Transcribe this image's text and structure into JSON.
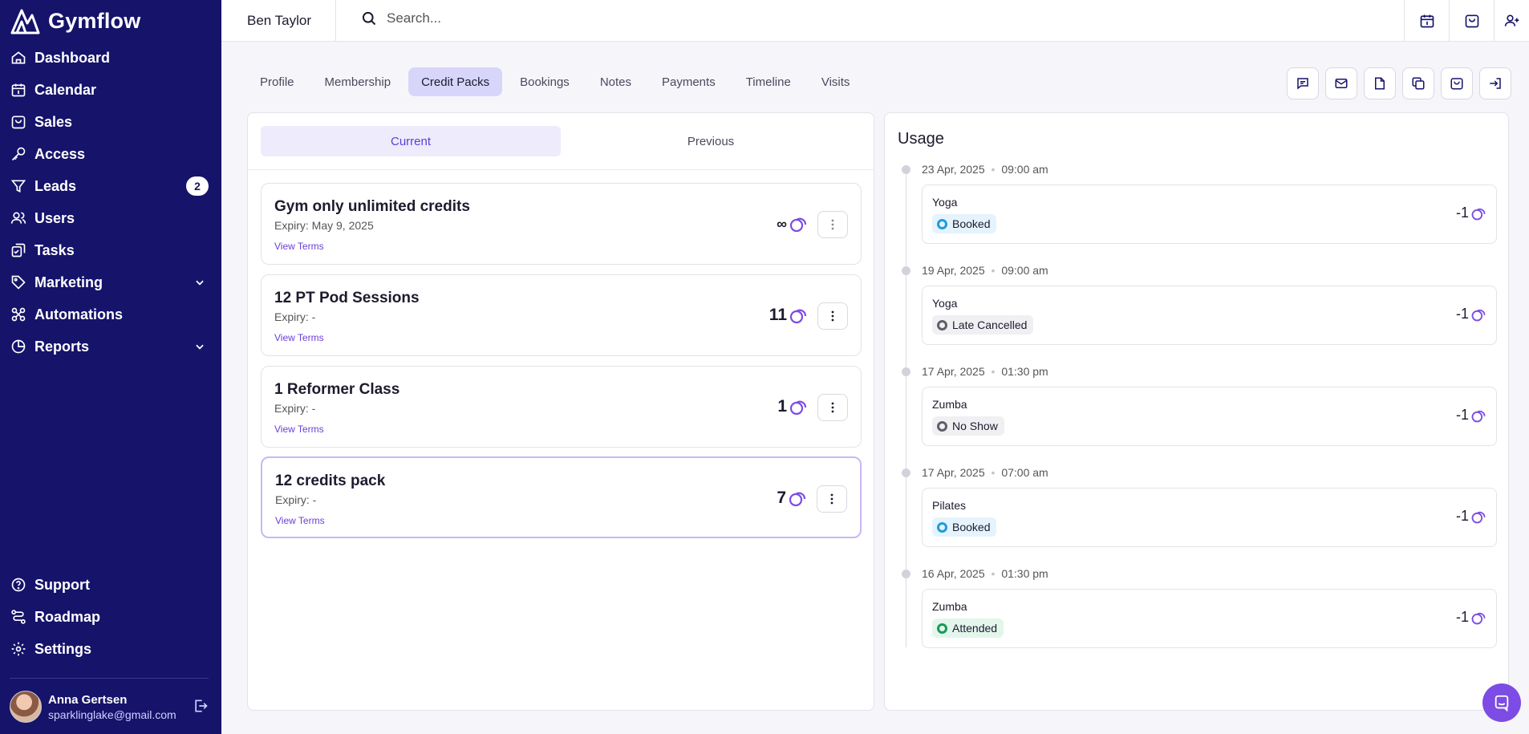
{
  "app": {
    "name": "Gymflow"
  },
  "sidebar": {
    "items": [
      {
        "label": "Dashboard",
        "icon": "home-icon"
      },
      {
        "label": "Calendar",
        "icon": "calendar-icon"
      },
      {
        "label": "Sales",
        "icon": "bag-icon"
      },
      {
        "label": "Access",
        "icon": "key-icon"
      },
      {
        "label": "Leads",
        "icon": "filter-icon",
        "badge": "2"
      },
      {
        "label": "Users",
        "icon": "users-icon"
      },
      {
        "label": "Tasks",
        "icon": "tasks-icon"
      },
      {
        "label": "Marketing",
        "icon": "tag-icon",
        "expandable": true
      },
      {
        "label": "Automations",
        "icon": "automation-icon"
      },
      {
        "label": "Reports",
        "icon": "pie-chart-icon",
        "expandable": true
      }
    ],
    "bottom_items": [
      {
        "label": "Support",
        "icon": "help-icon"
      },
      {
        "label": "Roadmap",
        "icon": "roadmap-icon"
      },
      {
        "label": "Settings",
        "icon": "gear-icon"
      }
    ],
    "user": {
      "name": "Anna Gertsen",
      "email": "sparklinglake@gmail.com"
    }
  },
  "topbar": {
    "member_name": "Ben Taylor",
    "search_placeholder": "Search..."
  },
  "tabs": [
    "Profile",
    "Membership",
    "Credit Packs",
    "Bookings",
    "Notes",
    "Payments",
    "Timeline",
    "Visits"
  ],
  "active_tab": "Credit Packs",
  "packs_panel": {
    "segments": [
      "Current",
      "Previous"
    ],
    "active_segment": "Current",
    "view_terms_label": "View Terms",
    "packs": [
      {
        "name": "Gym only unlimited credits",
        "expiry": "Expiry: May 9, 2025",
        "credits": "∞"
      },
      {
        "name": "12 PT Pod Sessions",
        "expiry": "Expiry: -",
        "credits": "11"
      },
      {
        "name": "1 Reformer Class",
        "expiry": "Expiry: -",
        "credits": "1"
      },
      {
        "name": "12 credits pack",
        "expiry": "Expiry: -",
        "credits": "7",
        "selected": true
      }
    ]
  },
  "usage": {
    "title": "Usage",
    "entries": [
      {
        "date": "23 Apr, 2025",
        "time": "09:00 am",
        "class": "Yoga",
        "status": "Booked",
        "delta": "-1"
      },
      {
        "date": "19 Apr, 2025",
        "time": "09:00 am",
        "class": "Yoga",
        "status": "Late Cancelled",
        "delta": "-1"
      },
      {
        "date": "17 Apr, 2025",
        "time": "01:30 pm",
        "class": "Zumba",
        "status": "No Show",
        "delta": "-1"
      },
      {
        "date": "17 Apr, 2025",
        "time": "07:00 am",
        "class": "Pilates",
        "status": "Booked",
        "delta": "-1"
      },
      {
        "date": "16 Apr, 2025",
        "time": "01:30 pm",
        "class": "Zumba",
        "status": "Attended",
        "delta": "-1"
      }
    ]
  },
  "colors": {
    "sidebar_bg": "#16136b",
    "accent": "#7c4ce4",
    "status_booked": "#1e9be0",
    "status_booked_bg": "#e4f3fc",
    "status_neutral": "#5e5f6b",
    "status_neutral_bg": "#f0f0f3",
    "status_attended": "#1a9a55",
    "status_attended_bg": "#e3f6ec"
  }
}
